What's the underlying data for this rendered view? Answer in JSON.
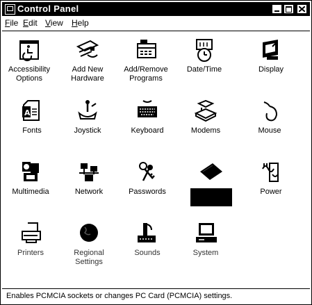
{
  "window": {
    "title": "Control Panel"
  },
  "menu": [
    {
      "acc": "F",
      "rest": "ile"
    },
    {
      "acc": "E",
      "rest": "dit"
    },
    {
      "acc": "V",
      "rest": "iew"
    },
    {
      "acc": "H",
      "rest": "elp"
    }
  ],
  "items": [
    {
      "line1": "Accessibility",
      "line2": "Options",
      "icon": "accessibility-icon"
    },
    {
      "line1": "Add New",
      "line2": "Hardware",
      "icon": "add-hardware-icon"
    },
    {
      "line1": "Add/Remove",
      "line2": "Programs",
      "icon": "add-remove-programs-icon"
    },
    {
      "line1": "Date/Time",
      "line2": "",
      "icon": "date-time-icon"
    },
    {
      "line1": "Display",
      "line2": "",
      "icon": "display-icon"
    },
    {
      "line1": "Fonts",
      "line2": "",
      "icon": "fonts-icon"
    },
    {
      "line1": "Joystick",
      "line2": "",
      "icon": "joystick-icon"
    },
    {
      "line1": "Keyboard",
      "line2": "",
      "icon": "keyboard-icon"
    },
    {
      "line1": "Modems",
      "line2": "",
      "icon": "modems-icon"
    },
    {
      "line1": "Mouse",
      "line2": "",
      "icon": "mouse-icon"
    },
    {
      "line1": "Multimedia",
      "line2": "",
      "icon": "multimedia-icon"
    },
    {
      "line1": "Network",
      "line2": "",
      "icon": "network-icon"
    },
    {
      "line1": "Passwords",
      "line2": "",
      "icon": "passwords-icon"
    },
    {
      "line1": "",
      "line2": "",
      "icon": "pc-card-icon"
    },
    {
      "line1": "Power",
      "line2": "",
      "icon": "power-icon"
    },
    {
      "line1": "Printers",
      "line2": "",
      "icon": "printers-icon"
    },
    {
      "line1": "Regional",
      "line2": "Settings",
      "icon": "regional-settings-icon"
    },
    {
      "line1": "Sounds",
      "line2": "",
      "icon": "sounds-icon"
    },
    {
      "line1": "System",
      "line2": "",
      "icon": "system-icon"
    }
  ],
  "status": {
    "text": "Enables PCMCIA sockets or changes PC Card (PCMCIA) settings."
  }
}
